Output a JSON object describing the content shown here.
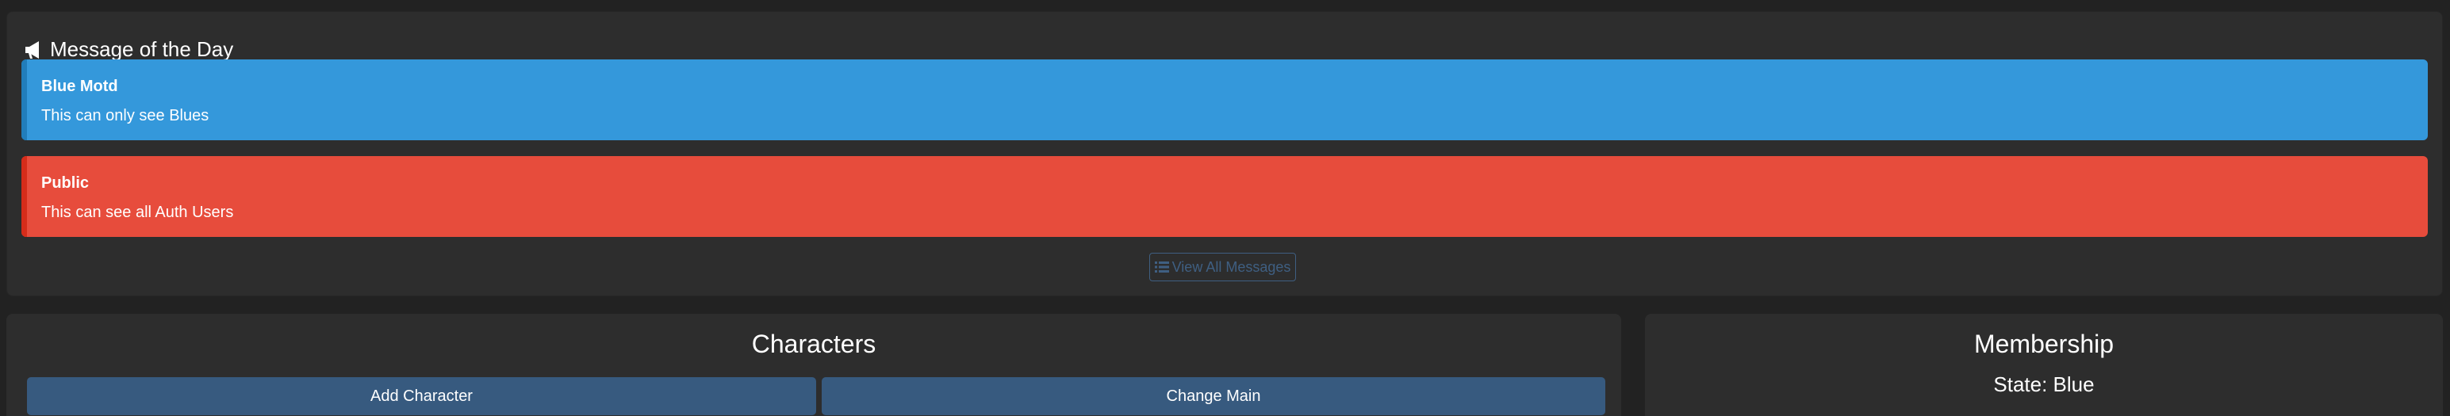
{
  "motd": {
    "header_title": "Message of the Day",
    "header_icon": "megaphone-icon",
    "messages": [
      {
        "title": "Blue Motd",
        "body": "This can only see Blues",
        "color": "#3498db"
      },
      {
        "title": "Public",
        "body": "This can see all Auth Users",
        "color": "#e74c3c"
      }
    ],
    "view_all_label": "View All Messages",
    "view_all_icon": "list-icon"
  },
  "characters": {
    "title": "Characters",
    "add_label": "Add Character",
    "change_main_label": "Change Main",
    "button_color": "#375a7f"
  },
  "membership": {
    "title": "Membership",
    "state_text": "State: Blue"
  }
}
